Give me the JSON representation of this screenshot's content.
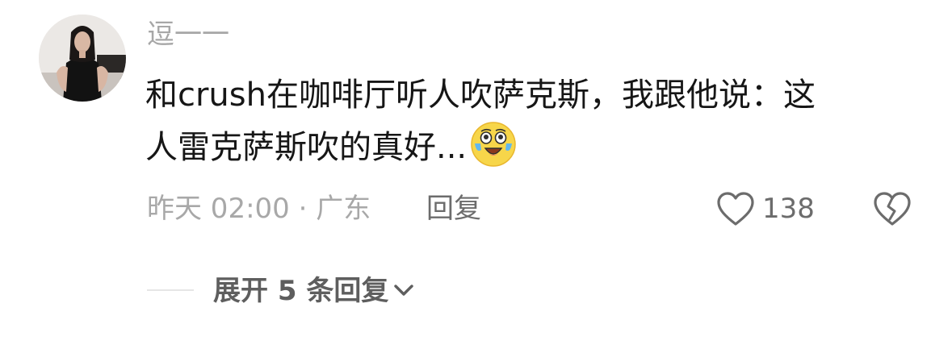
{
  "comment": {
    "username": "逗一一",
    "text_line1": "和crush在咖啡厅听人吹萨克斯，我跟他说：这",
    "text_line2": "人雷克萨斯吹的真好...",
    "emoji": "laughing-crying-emoji",
    "meta": "昨天 02:00 · 广东",
    "reply_label": "回复",
    "like_count": "138",
    "expand_label": "展开 5 条回复"
  },
  "icons": {
    "like": "heart-outline-icon",
    "dislike": "broken-heart-icon",
    "expand": "chevron-down-icon"
  },
  "colors": {
    "username": "#a7a7a7",
    "body_text": "#161616",
    "meta_text": "#a8a8a8",
    "action_text": "#6c6c6c"
  }
}
